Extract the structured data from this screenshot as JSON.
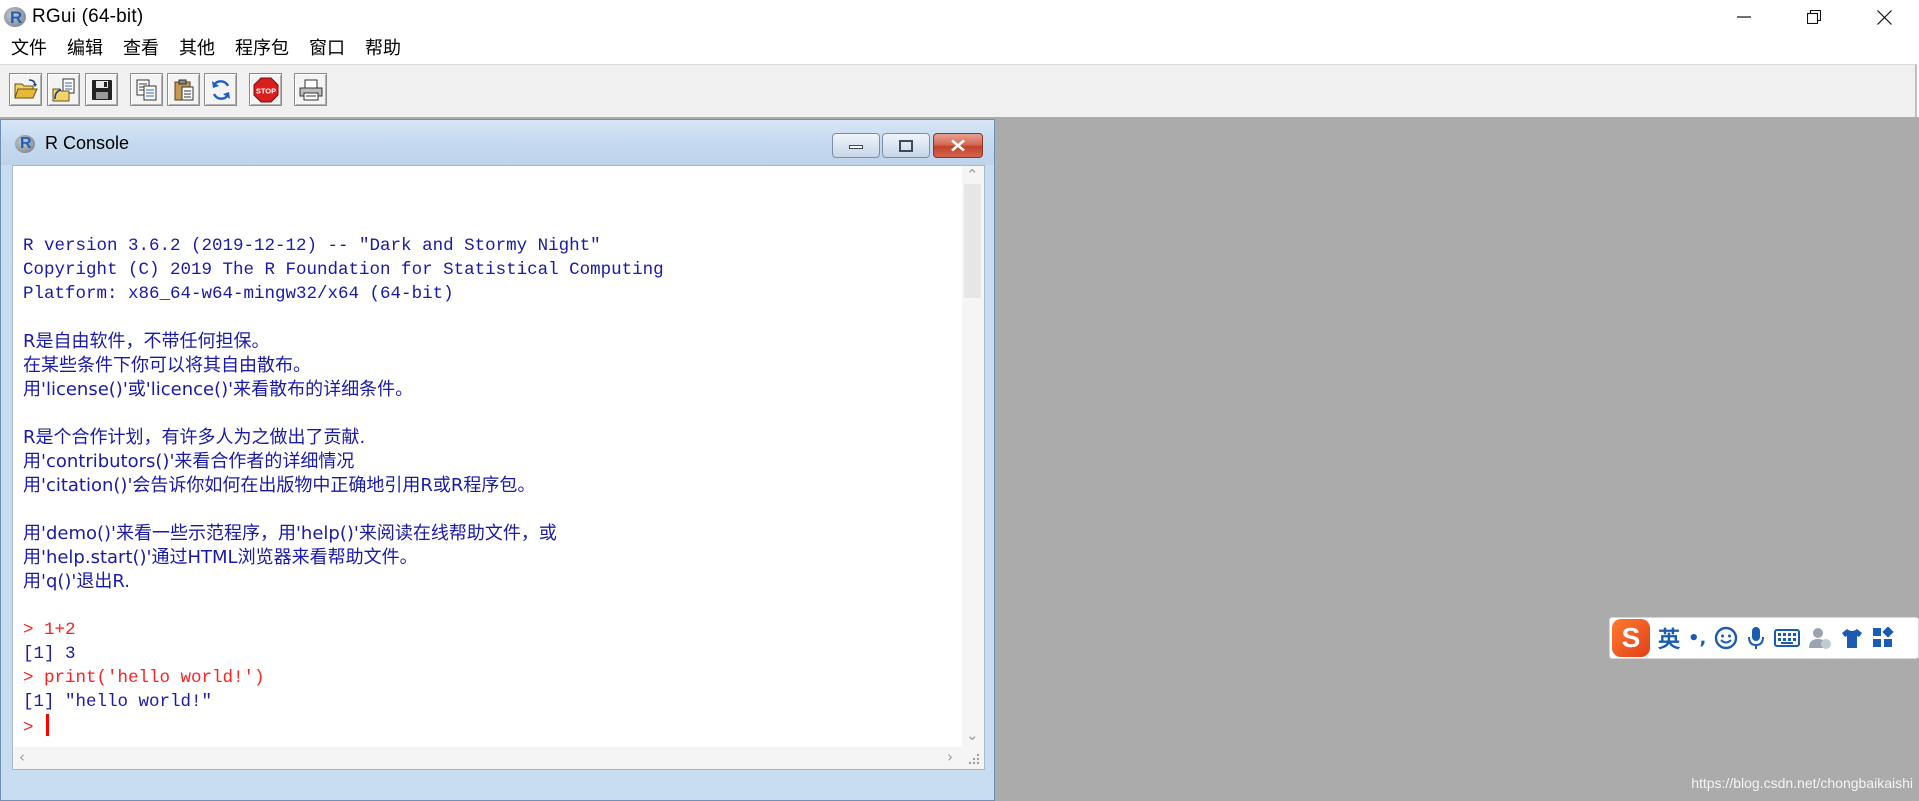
{
  "app": {
    "title": "RGui (64-bit)",
    "window_controls": [
      "minimize",
      "restore",
      "close"
    ]
  },
  "menubar": {
    "items": [
      "文件",
      "编辑",
      "查看",
      "其他",
      "程序包",
      "窗口",
      "帮助"
    ]
  },
  "toolbar": {
    "buttons": [
      {
        "name": "open-script-icon"
      },
      {
        "name": "load-workspace-icon"
      },
      {
        "name": "save-workspace-icon"
      },
      {
        "name": "copy-icon"
      },
      {
        "name": "paste-icon"
      },
      {
        "name": "copy-paste-icon"
      },
      {
        "name": "stop-icon",
        "label": "STOP"
      },
      {
        "name": "print-icon"
      }
    ]
  },
  "console": {
    "title": "R Console",
    "lines": [
      {
        "text": "",
        "kind": "blank"
      },
      {
        "text": "R version 3.6.2 (2019-12-12) -- \"Dark and Stormy Night\"",
        "kind": "output"
      },
      {
        "text": "Copyright (C) 2019 The R Foundation for Statistical Computing",
        "kind": "output"
      },
      {
        "text": "Platform: x86_64-w64-mingw32/x64 (64-bit)",
        "kind": "output"
      },
      {
        "text": "",
        "kind": "blank"
      },
      {
        "text": "R是自由软件，不带任何担保。",
        "kind": "output"
      },
      {
        "text": "在某些条件下你可以将其自由散布。",
        "kind": "output"
      },
      {
        "text": "用'license()'或'licence()'来看散布的详细条件。",
        "kind": "output"
      },
      {
        "text": "",
        "kind": "blank"
      },
      {
        "text": "R是个合作计划，有许多人为之做出了贡献.",
        "kind": "output"
      },
      {
        "text": "用'contributors()'来看合作者的详细情况",
        "kind": "output"
      },
      {
        "text": "用'citation()'会告诉你如何在出版物中正确地引用R或R程序包。",
        "kind": "output"
      },
      {
        "text": "",
        "kind": "blank"
      },
      {
        "text": "用'demo()'来看一些示范程序，用'help()'来阅读在线帮助文件，或",
        "kind": "output"
      },
      {
        "text": "用'help.start()'通过HTML浏览器来看帮助文件。",
        "kind": "output"
      },
      {
        "text": "用'q()'退出R.",
        "kind": "output"
      },
      {
        "text": "",
        "kind": "blank"
      },
      {
        "text": "> 1+2",
        "kind": "input"
      },
      {
        "text": "[1] 3",
        "kind": "output"
      },
      {
        "text": "> print('hello world!')",
        "kind": "input"
      },
      {
        "text": "[1] \"hello world!\"",
        "kind": "output"
      },
      {
        "text": "> ",
        "kind": "prompt"
      }
    ]
  },
  "ime": {
    "logo": "S",
    "mode": "英",
    "punct": "•,",
    "icons": [
      "emoji-icon",
      "microphone-icon",
      "keyboard-icon",
      "user-icon",
      "skin-icon",
      "toolbox-icon"
    ]
  },
  "watermark": "https://blog.csdn.net/chongbaikaishi",
  "colors": {
    "output_text": "#1a1aa8",
    "input_text": "#ff2020",
    "mdi_background": "#ababab",
    "ime_blue": "#1a5db0"
  }
}
